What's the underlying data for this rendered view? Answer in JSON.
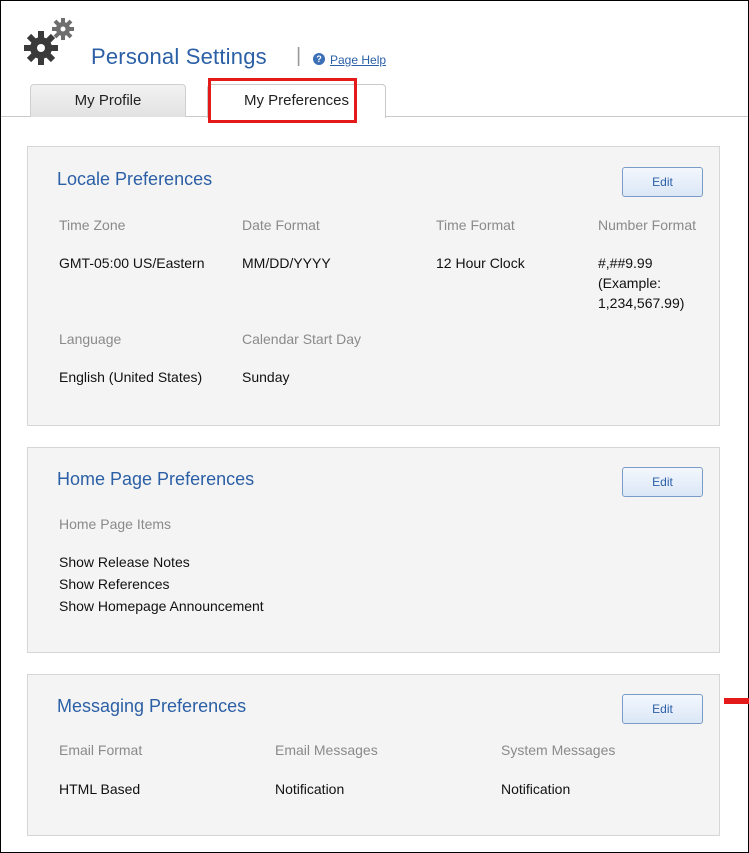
{
  "header": {
    "title": "Personal Settings",
    "separator": "|",
    "help_label": "Page Help"
  },
  "tabs": [
    {
      "label": "My Profile",
      "active": false
    },
    {
      "label": "My Preferences",
      "active": true
    }
  ],
  "locale": {
    "title": "Locale Preferences",
    "edit_label": "Edit",
    "fields": {
      "time_zone": {
        "label": "Time Zone",
        "value": "GMT-05:00 US/Eastern"
      },
      "date_format": {
        "label": "Date Format",
        "value": "MM/DD/YYYY"
      },
      "time_format": {
        "label": "Time Format",
        "value": "12 Hour Clock"
      },
      "number_format": {
        "label": "Number Format",
        "value_lines": [
          "#,##9.99",
          "(Example:",
          "1,234,567.99)"
        ]
      },
      "language": {
        "label": "Language",
        "value": "English (United States)"
      },
      "calendar_start": {
        "label": "Calendar Start Day",
        "value": "Sunday"
      }
    }
  },
  "home": {
    "title": "Home Page Preferences",
    "edit_label": "Edit",
    "items_label": "Home Page Items",
    "items": [
      "Show Release Notes",
      "Show References",
      "Show Homepage Announcement"
    ]
  },
  "messaging": {
    "title": "Messaging Preferences",
    "edit_label": "Edit",
    "fields": {
      "email_format": {
        "label": "Email Format",
        "value": "HTML Based"
      },
      "email_messages": {
        "label": "Email Messages",
        "value": "Notification"
      },
      "system_messages": {
        "label": "System Messages",
        "value": "Notification"
      }
    }
  },
  "colors": {
    "accent": "#2b5fa6",
    "highlight": "#e41a1a",
    "panel_bg": "#f4f4f4"
  },
  "icons": {
    "header": "gear-icon",
    "help": "help-icon"
  }
}
